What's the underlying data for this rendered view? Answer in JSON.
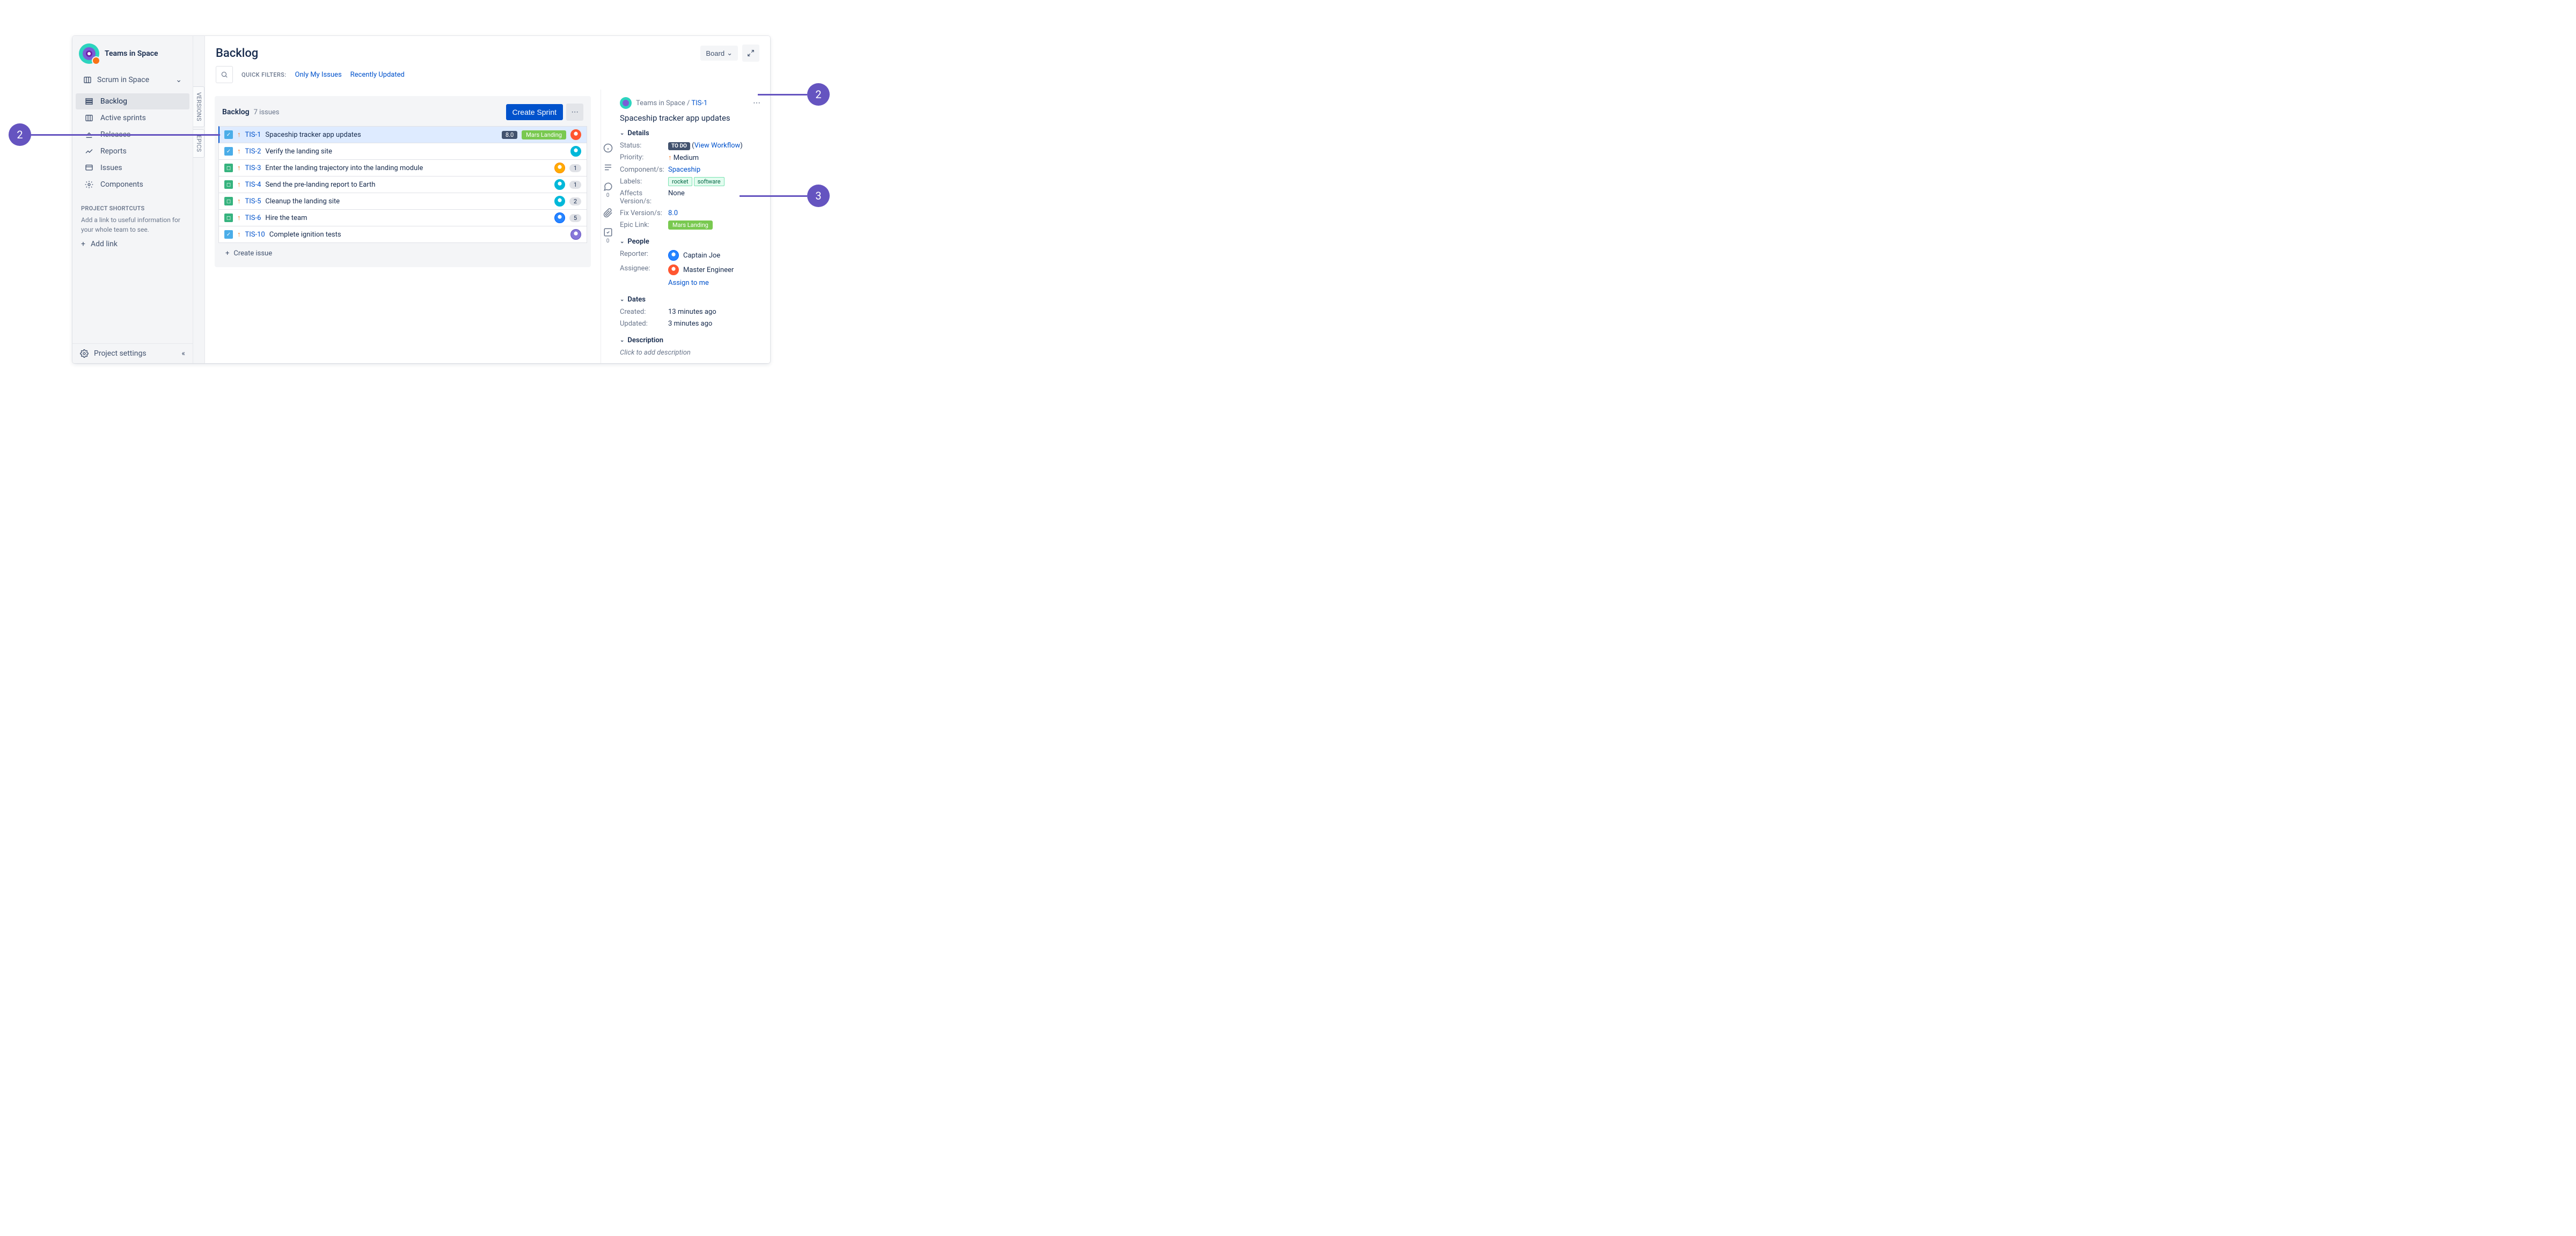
{
  "sidebar": {
    "project_name": "Teams in Space",
    "board_selector": "Scrum in Space",
    "nav": [
      {
        "label": "Backlog",
        "active": true
      },
      {
        "label": "Active sprints"
      },
      {
        "label": "Releases"
      },
      {
        "label": "Reports"
      },
      {
        "label": "Issues"
      },
      {
        "label": "Components"
      }
    ],
    "shortcuts_header": "PROJECT SHORTCUTS",
    "shortcuts_help": "Add a link to useful information for your whole team to see.",
    "add_link": "Add link",
    "project_settings": "Project settings"
  },
  "vtabs": {
    "versions": "VERSIONS",
    "epics": "EPICS"
  },
  "header": {
    "title": "Backlog",
    "board_button": "Board",
    "quick_filters_label": "QUICK FILTERS:",
    "filter_only_my": "Only My Issues",
    "filter_recent": "Recently Updated"
  },
  "backlog": {
    "title": "Backlog",
    "count": "7 issues",
    "create_sprint": "Create Sprint",
    "create_issue": "Create issue",
    "issues": [
      {
        "type": "task",
        "key": "TIS-1",
        "summary": "Spaceship tracker app updates",
        "version": "8.0",
        "epic": "Mars Landing",
        "avatar": "red",
        "selected": true
      },
      {
        "type": "task",
        "key": "TIS-2",
        "summary": "Verify the landing site",
        "avatar": "teal"
      },
      {
        "type": "story",
        "key": "TIS-3",
        "summary": "Enter the landing trajectory into the landing module",
        "avatar": "yellow",
        "count": "1"
      },
      {
        "type": "story",
        "key": "TIS-4",
        "summary": "Send the pre-landing report to Earth",
        "avatar": "teal",
        "count": "1"
      },
      {
        "type": "story",
        "key": "TIS-5",
        "summary": "Cleanup the landing site",
        "avatar": "teal",
        "count": "2"
      },
      {
        "type": "story",
        "key": "TIS-6",
        "summary": "Hire the team",
        "avatar": "blue",
        "count": "5"
      },
      {
        "type": "task",
        "key": "TIS-10",
        "summary": "Complete ignition tests",
        "avatar": "purple"
      }
    ]
  },
  "rail": {
    "comments": "0",
    "subtasks": "0"
  },
  "detail": {
    "breadcrumb_project": "Teams in Space",
    "breadcrumb_sep": " / ",
    "breadcrumb_key": "TIS-1",
    "title": "Spaceship tracker app updates",
    "sections": {
      "details": "Details",
      "people": "People",
      "dates": "Dates",
      "description": "Description"
    },
    "labels": {
      "status": "Status:",
      "priority": "Priority:",
      "components": "Component/s:",
      "labels_l": "Labels:",
      "affects": "Affects Version/s:",
      "fix": "Fix Version/s:",
      "epic": "Epic Link:",
      "reporter": "Reporter:",
      "assignee": "Assignee:",
      "created": "Created:",
      "updated": "Updated:"
    },
    "values": {
      "status_lozenge": "TO DO",
      "view_workflow": "View Workflow",
      "priority": "Medium",
      "components": "Spaceship",
      "label1": "rocket",
      "label2": "software",
      "affects": "None",
      "fix": "8.0",
      "epic": "Mars Landing",
      "reporter": "Captain Joe",
      "assignee": "Master Engineer",
      "assign_to_me": "Assign to me",
      "created": "13 minutes ago",
      "updated": "3 minutes ago",
      "desc_placeholder": "Click to add description"
    }
  },
  "callouts": {
    "left": "2",
    "right_top": "2",
    "right_bottom": "3"
  }
}
